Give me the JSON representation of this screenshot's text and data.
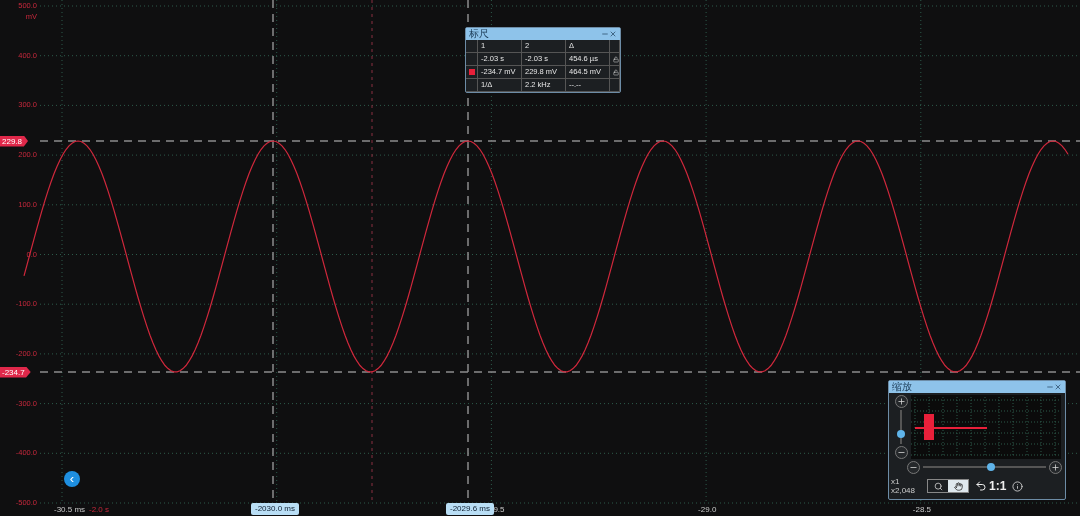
{
  "y_axis": {
    "unit": "mV",
    "ticks": [
      "500.0",
      "400.0",
      "300.0",
      "200.0",
      "100.0",
      "0.0",
      "-100.0",
      "-200.0",
      "-300.0",
      "-400.0",
      "-500.0"
    ]
  },
  "x_axis": {
    "ticks": [
      "-30.5 ms",
      "9.5",
      "-29.0",
      "-28.5"
    ],
    "offset": "-2.0 s"
  },
  "level_markers": [
    "229.8",
    "-234.7"
  ],
  "time_cursors": [
    "-2030.0 ms",
    "-2029.6 ms"
  ],
  "back_button": {
    "label": "‹"
  },
  "ruler_window": {
    "title": "标尺",
    "header": [
      "1",
      "2",
      "Δ"
    ],
    "rows": [
      {
        "cells": [
          "-2.03 s",
          "-2.03 s",
          "454.6 µs"
        ],
        "locked": true
      },
      {
        "color": "#e8203a",
        "cells": [
          "-234.7 mV",
          "229.8 mV",
          "464.5 mV"
        ],
        "locked": true
      },
      {
        "cells": [
          "1/Δ",
          "2.2 kHz",
          "--.--"
        ],
        "locked": false
      }
    ]
  },
  "zoom_window": {
    "title": "缩放",
    "vertical_zoom": {
      "level": 0.3
    },
    "horizontal_zoom": {
      "level": 0.55
    },
    "factors": [
      "x1",
      "x2,048"
    ],
    "modes": [
      {
        "kind": "zoom",
        "selected": false
      },
      {
        "kind": "pan",
        "selected": true
      }
    ],
    "reset_label": "1:1"
  }
}
